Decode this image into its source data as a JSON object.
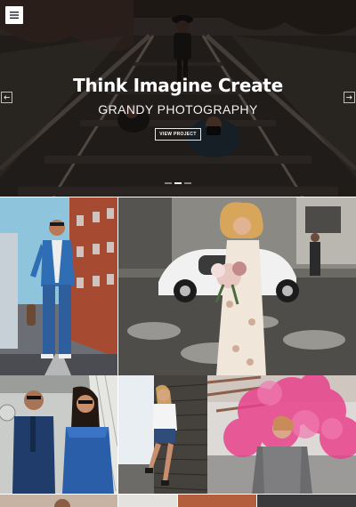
{
  "hero": {
    "title": "Think Imagine Create",
    "subtitle": "GRANDY PHOTOGRAPHY",
    "button_label": "VIEW PROJECT",
    "slide_count": 3,
    "active_slide": 1
  },
  "icons": {
    "menu": "hamburger-menu-icon",
    "prev": "arrow-left-icon",
    "next": "arrow-right-icon"
  },
  "gallery": {
    "items": [
      {
        "subject": "man-in-blue-suit-street"
      },
      {
        "subject": "bride-with-bouquet-vintage-car"
      },
      {
        "subject": "couple-in-sunglasses"
      },
      {
        "subject": "woman-by-wooden-wall"
      },
      {
        "subject": "woman-in-pink-smoke"
      }
    ]
  },
  "colors": {
    "accent": "#ffffff",
    "hero_overlay": "#1f1b18"
  }
}
